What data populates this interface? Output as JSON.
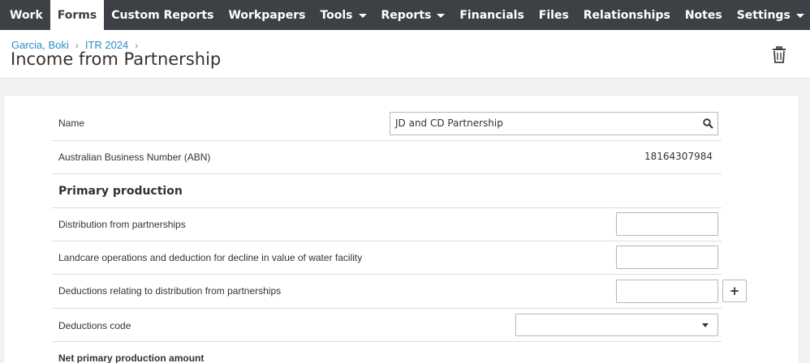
{
  "nav": {
    "items": [
      {
        "label": "Work",
        "dropdown": false,
        "active": false
      },
      {
        "label": "Forms",
        "dropdown": false,
        "active": true
      },
      {
        "label": "Custom Reports",
        "dropdown": false,
        "active": false
      },
      {
        "label": "Workpapers",
        "dropdown": false,
        "active": false
      },
      {
        "label": "Tools",
        "dropdown": true,
        "active": false
      },
      {
        "label": "Reports",
        "dropdown": true,
        "active": false
      },
      {
        "label": "Financials",
        "dropdown": false,
        "active": false
      },
      {
        "label": "Files",
        "dropdown": false,
        "active": false
      },
      {
        "label": "Relationships",
        "dropdown": false,
        "active": false
      },
      {
        "label": "Notes",
        "dropdown": false,
        "active": false
      },
      {
        "label": "Settings",
        "dropdown": true,
        "active": false
      }
    ]
  },
  "breadcrumb": {
    "items": [
      "Garcia, Boki",
      "ITR 2024"
    ],
    "separator": "›"
  },
  "page": {
    "title": "Income from Partnership",
    "delete_icon": "trash-icon"
  },
  "form": {
    "name_label": "Name",
    "name_value": "JD and CD Partnership",
    "name_icon": "search-icon",
    "abn_label": "Australian Business Number (ABN)",
    "abn_value": "18164307984",
    "section_primary": "Primary production",
    "distribution_label": "Distribution from partnerships",
    "distribution_value": "",
    "landcare_label": "Landcare operations and deduction for decline in value of water facility",
    "landcare_value": "",
    "deductions_label": "Deductions relating to distribution from partnerships",
    "deductions_value": "",
    "add_button_label": "+",
    "deductions_code_label": "Deductions code",
    "deductions_code_value": "",
    "net_label": "Net primary production amount"
  },
  "colors": {
    "nav_bg": "#3d4146",
    "link": "#2a8fc4",
    "page_bg": "#f2f2f2"
  }
}
